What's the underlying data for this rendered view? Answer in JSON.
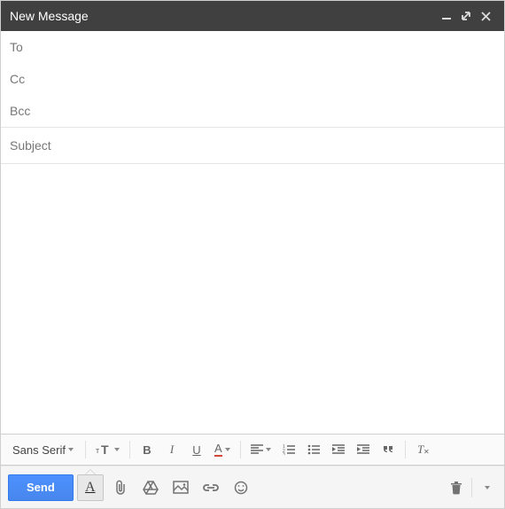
{
  "header": {
    "title": "New Message"
  },
  "recipients": {
    "to_label": "To",
    "cc_label": "Cc",
    "bcc_label": "Bcc"
  },
  "subject": {
    "placeholder": "Subject",
    "value": ""
  },
  "body": {
    "value": ""
  },
  "format": {
    "font_label": "Sans Serif",
    "size_glyph": "тT",
    "bold": "B",
    "italic": "I",
    "underline": "U",
    "text_color": "A"
  },
  "actions": {
    "send_label": "Send",
    "format_toggle": "A"
  }
}
